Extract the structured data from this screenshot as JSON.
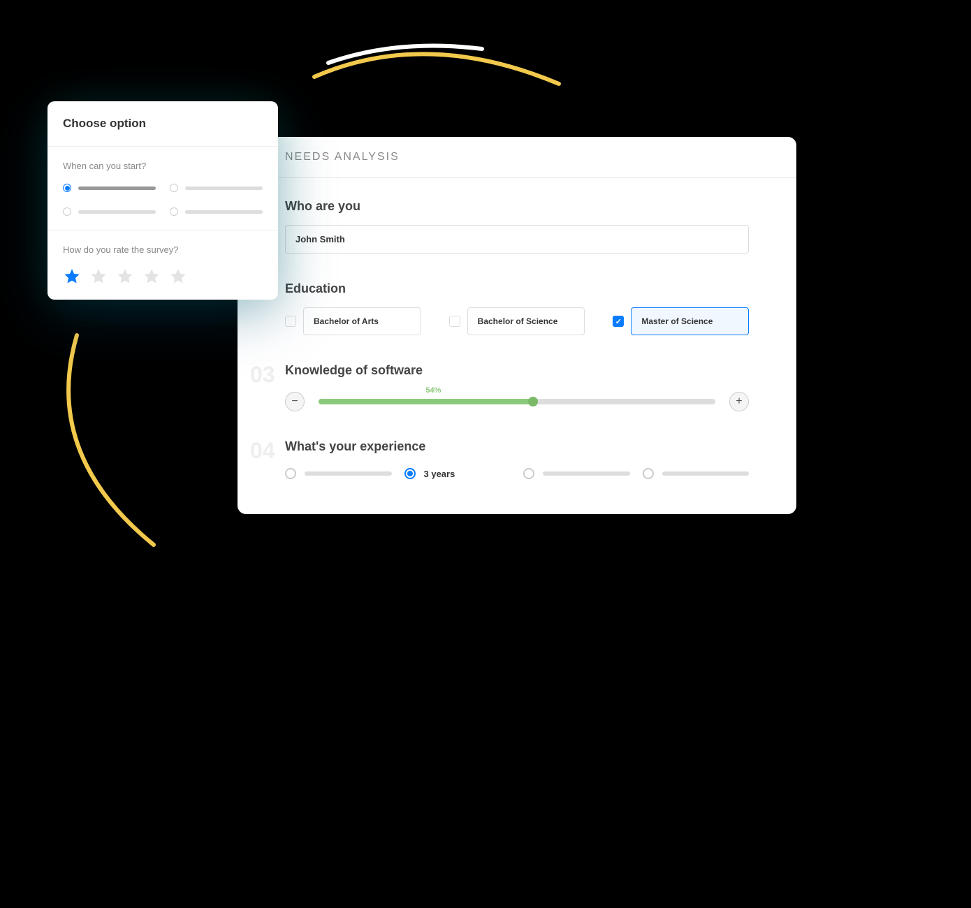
{
  "main": {
    "header": "NEEDS ANALYSIS",
    "sections": {
      "who": {
        "title": "Who are you",
        "value": "John Smith"
      },
      "education": {
        "title": "Education",
        "options": [
          {
            "label": "Bachelor of Arts",
            "checked": false
          },
          {
            "label": "Bachelor of Science",
            "checked": false
          },
          {
            "label": "Master of Science",
            "checked": true
          }
        ]
      },
      "software": {
        "num": "03",
        "title": "Knowledge of software",
        "percent": "54%",
        "value": 54
      },
      "experience": {
        "num": "04",
        "title": "What's your experience",
        "selected_label": "3 years",
        "selected_index": 1,
        "count": 4
      }
    }
  },
  "card": {
    "title": "Choose option",
    "q1": {
      "text": "When can you start?",
      "selected_index": 0,
      "count": 4
    },
    "q2": {
      "text": "How do you rate the survey?",
      "rating": 1,
      "max": 5
    }
  },
  "icons": {
    "minus": "−",
    "plus": "+"
  }
}
